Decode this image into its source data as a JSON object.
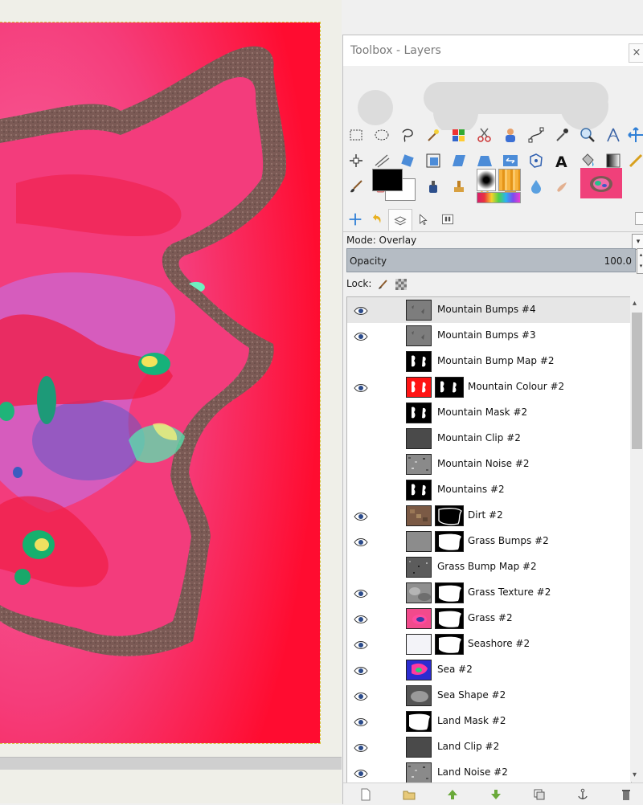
{
  "window": {
    "title": "Toolbox - Layers",
    "close_label": "×"
  },
  "layers_panel": {
    "mode_label": "Mode: Overlay",
    "opacity_label": "Opacity",
    "opacity_value": "100.0",
    "lock_label": "Lock:"
  },
  "layers": [
    {
      "name": "Mountain Bumps #4",
      "visible": true,
      "thumb": "gray-bumps",
      "mask": null,
      "selected": true
    },
    {
      "name": "Mountain Bumps #3",
      "visible": true,
      "thumb": "gray-bumps",
      "mask": null
    },
    {
      "name": "Mountain Bump Map #2",
      "visible": false,
      "thumb": "black-shapes",
      "mask": null
    },
    {
      "name": "Mountain Colour #2",
      "visible": true,
      "thumb": "red-shapes",
      "mask": "shapes"
    },
    {
      "name": "Mountain Mask #2",
      "visible": false,
      "thumb": "black-shapes",
      "mask": null
    },
    {
      "name": "Mountain Clip #2",
      "visible": false,
      "thumb": "dark-gray",
      "mask": null
    },
    {
      "name": "Mountain Noise #2",
      "visible": false,
      "thumb": "noise",
      "mask": null
    },
    {
      "name": "Mountains #2",
      "visible": false,
      "thumb": "black-shapes",
      "mask": null
    },
    {
      "name": "Dirt #2",
      "visible": true,
      "thumb": "dirt",
      "mask": "outline"
    },
    {
      "name": "Grass Bumps #2",
      "visible": true,
      "thumb": "gray",
      "mask": "land"
    },
    {
      "name": "Grass Bump Map #2",
      "visible": false,
      "thumb": "noise-dark",
      "mask": null
    },
    {
      "name": "Grass Texture #2",
      "visible": true,
      "thumb": "cloud",
      "mask": "land"
    },
    {
      "name": "Grass #2",
      "visible": true,
      "thumb": "pink",
      "mask": "land"
    },
    {
      "name": "Seashore #2",
      "visible": true,
      "thumb": "white",
      "mask": "land"
    },
    {
      "name": "Sea #2",
      "visible": true,
      "thumb": "sea",
      "mask": null
    },
    {
      "name": "Sea Shape #2",
      "visible": true,
      "thumb": "cloud-dark",
      "mask": null
    },
    {
      "name": "Land Mask #2",
      "visible": true,
      "thumb": "land-mask",
      "mask": null
    },
    {
      "name": "Land Clip #2",
      "visible": true,
      "thumb": "dark-gray",
      "mask": null
    },
    {
      "name": "Land Noise #2",
      "visible": true,
      "thumb": "noise",
      "mask": null
    }
  ],
  "tools": [
    "rect-select-icon",
    "ellipse-select-icon",
    "free-select-icon",
    "fuzzy-select-icon",
    "select-by-color-icon",
    "scissors-icon",
    "foreground-select-icon",
    "paths-icon",
    "color-picker-icon",
    "zoom-icon",
    "measure-icon",
    "move-icon",
    "align-icon",
    "crop-icon",
    "rotate-icon",
    "scale-icon",
    "shear-icon",
    "perspective-icon",
    "flip-icon",
    "cage-icon",
    "text-icon",
    "bucket-fill-icon",
    "blend-icon",
    "pencil-icon",
    "paintbrush-icon",
    "eraser-icon",
    "airbrush-icon",
    "ink-icon",
    "clone-icon",
    "heal-icon",
    "perspective-clone-icon",
    "blur-icon",
    "smudge-icon",
    "dodge-burn-icon"
  ],
  "colors": {
    "canvas_bg": "#ff1238",
    "land": "#f64090",
    "dirt": "#7b5e58",
    "accent_blue": "#2f7fd6"
  }
}
